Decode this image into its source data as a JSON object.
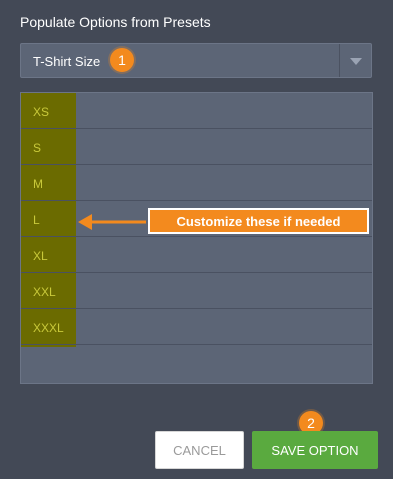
{
  "section": {
    "title": "Populate Options from Presets"
  },
  "preset_select": {
    "value": "T-Shirt Size",
    "arrow_icon": "caret-down-icon"
  },
  "badges": {
    "step1": "1",
    "step2": "2"
  },
  "options": [
    {
      "label": "XS"
    },
    {
      "label": "S"
    },
    {
      "label": "M"
    },
    {
      "label": "L"
    },
    {
      "label": "XL"
    },
    {
      "label": "XXL"
    },
    {
      "label": "XXXL"
    },
    {
      "label": ""
    }
  ],
  "callout": {
    "text": "Customize these if needed"
  },
  "buttons": {
    "cancel": "CANCEL",
    "save": "SAVE OPTION"
  },
  "colors": {
    "background": "#434956",
    "accent_orange": "#f38a1e",
    "size_highlight": "#6b6b00",
    "save_green": "#5aaa3f"
  }
}
